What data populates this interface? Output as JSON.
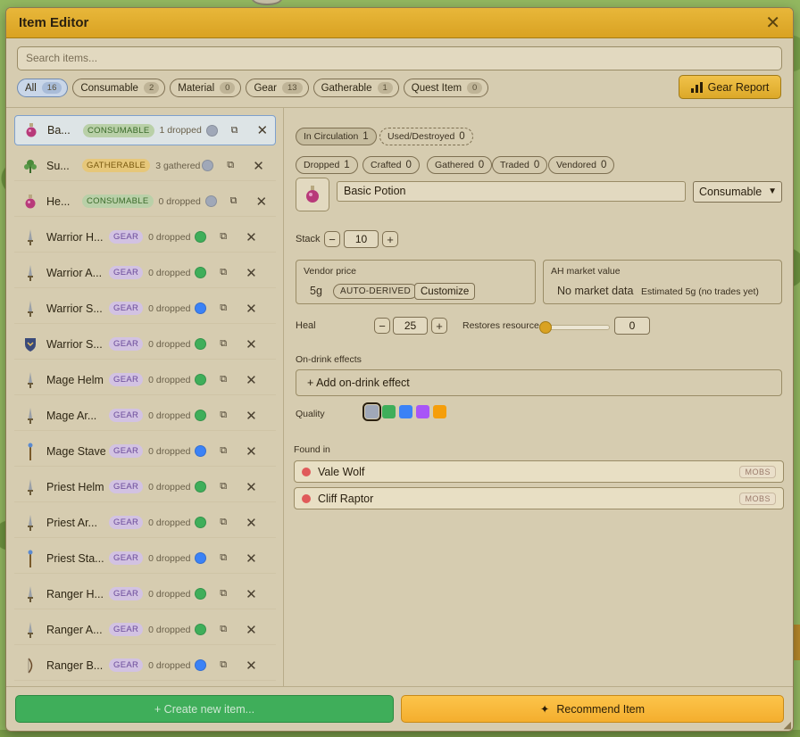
{
  "window": {
    "title": "Item Editor"
  },
  "search": {
    "placeholder": "Search items..."
  },
  "filters": [
    {
      "label": "All",
      "count": "16"
    },
    {
      "label": "Consumable",
      "count": "2"
    },
    {
      "label": "Material",
      "count": "0"
    },
    {
      "label": "Gear",
      "count": "13"
    },
    {
      "label": "Gatherable",
      "count": "1"
    },
    {
      "label": "Quest Item",
      "count": "0"
    }
  ],
  "gear_report": {
    "label": "Gear Report"
  },
  "items": [
    {
      "name": "Ba...",
      "type": "CONSUMABLE",
      "stat": "1 dropped",
      "quality": "#a0a8b8",
      "icon": "potion-icon"
    },
    {
      "name": "Su...",
      "type": "GATHERABLE",
      "stat": "3 gathered",
      "quality": "#a0a8b8",
      "icon": "herb-icon"
    },
    {
      "name": "He...",
      "type": "CONSUMABLE",
      "stat": "0 dropped",
      "quality": "#a0a8b8",
      "icon": "potion-icon"
    },
    {
      "name": "Warrior H...",
      "type": "GEAR",
      "stat": "0 dropped",
      "quality": "#3fae5a",
      "icon": "sword-icon"
    },
    {
      "name": "Warrior A...",
      "type": "GEAR",
      "stat": "0 dropped",
      "quality": "#3fae5a",
      "icon": "sword-icon"
    },
    {
      "name": "Warrior S...",
      "type": "GEAR",
      "stat": "0 dropped",
      "quality": "#3b82f6",
      "icon": "sword-icon"
    },
    {
      "name": "Warrior S...",
      "type": "GEAR",
      "stat": "0 dropped",
      "quality": "#3fae5a",
      "icon": "shield-icon"
    },
    {
      "name": "Mage Helm",
      "type": "GEAR",
      "stat": "0 dropped",
      "quality": "#3fae5a",
      "icon": "sword-icon"
    },
    {
      "name": "Mage Ar...",
      "type": "GEAR",
      "stat": "0 dropped",
      "quality": "#3fae5a",
      "icon": "sword-icon"
    },
    {
      "name": "Mage Stave",
      "type": "GEAR",
      "stat": "0 dropped",
      "quality": "#3b82f6",
      "icon": "staff-icon"
    },
    {
      "name": "Priest Helm",
      "type": "GEAR",
      "stat": "0 dropped",
      "quality": "#3fae5a",
      "icon": "sword-icon"
    },
    {
      "name": "Priest Ar...",
      "type": "GEAR",
      "stat": "0 dropped",
      "quality": "#3fae5a",
      "icon": "sword-icon"
    },
    {
      "name": "Priest Sta...",
      "type": "GEAR",
      "stat": "0 dropped",
      "quality": "#3b82f6",
      "icon": "staff-icon"
    },
    {
      "name": "Ranger H...",
      "type": "GEAR",
      "stat": "0 dropped",
      "quality": "#3fae5a",
      "icon": "sword-icon"
    },
    {
      "name": "Ranger A...",
      "type": "GEAR",
      "stat": "0 dropped",
      "quality": "#3fae5a",
      "icon": "sword-icon"
    },
    {
      "name": "Ranger B...",
      "type": "GEAR",
      "stat": "0 dropped",
      "quality": "#3b82f6",
      "icon": "bow-icon"
    }
  ],
  "detail": {
    "circulation": [
      {
        "label": "In Circulation",
        "count": "1"
      },
      {
        "label": "Used/Destroyed",
        "count": "0"
      }
    ],
    "sources": [
      {
        "label": "Dropped",
        "count": "1"
      },
      {
        "label": "Crafted",
        "count": "0"
      },
      {
        "label": "Gathered",
        "count": "0"
      },
      {
        "label": "Traded",
        "count": "0"
      },
      {
        "label": "Vendored",
        "count": "0"
      }
    ],
    "name": "Basic Potion",
    "type": "Consumable",
    "stack_label": "Stack",
    "stack_value": "10",
    "vendor_label": "Vendor price",
    "vendor_price": "5g",
    "vendor_tag": "AUTO-DERIVED",
    "customize_label": "Customize",
    "ah_label": "AH market value",
    "ah_value": "No market data",
    "ah_estimate": "Estimated 5g (no trades yet)",
    "heal_label": "Heal",
    "heal_value": "25",
    "restores_label": "Restores resource",
    "restores_value": "0",
    "restores_level": 0,
    "on_drink_label": "On-drink effects",
    "add_effect_label": "+ Add on-drink effect",
    "quality_label": "Quality",
    "quality_colors": [
      "#a0a8b8",
      "#3fae5a",
      "#3b82f6",
      "#a855f7",
      "#f59e0b"
    ],
    "found_label": "Found in",
    "found_in": [
      {
        "name": "Vale Wolf",
        "tag": "MOBS"
      },
      {
        "name": "Cliff Raptor",
        "tag": "MOBS"
      }
    ]
  },
  "footer": {
    "create_label": "+ Create new item...",
    "recommend_label": "Recommend Item"
  }
}
